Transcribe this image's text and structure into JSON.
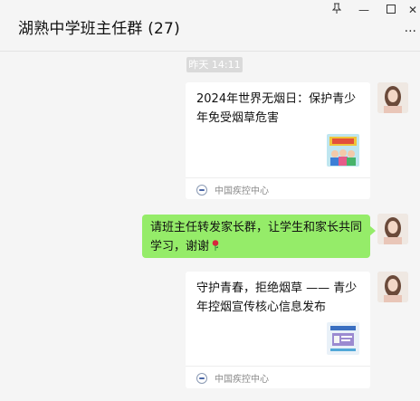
{
  "window": {
    "title": "湖熟中学班主任群 (27)",
    "pin_glyph": "⊥",
    "minimize_glyph": "—",
    "maximize_glyph": "☐",
    "close_glyph": "✕",
    "more_glyph": "..."
  },
  "chat": {
    "timestamp": "昨天 14:11",
    "messages": [
      {
        "type": "link-card",
        "title": "2024年世界无烟日：保护青少年免受烟草危害",
        "source": "中国疾控中心"
      },
      {
        "type": "text",
        "text": "请班主任转发家长群，让学生和家长共同学习，谢谢"
      },
      {
        "type": "link-card",
        "title": "守护青春，拒绝烟草 —— 青少年控烟宣传核心信息发布",
        "source": "中国疾控中心"
      }
    ]
  }
}
